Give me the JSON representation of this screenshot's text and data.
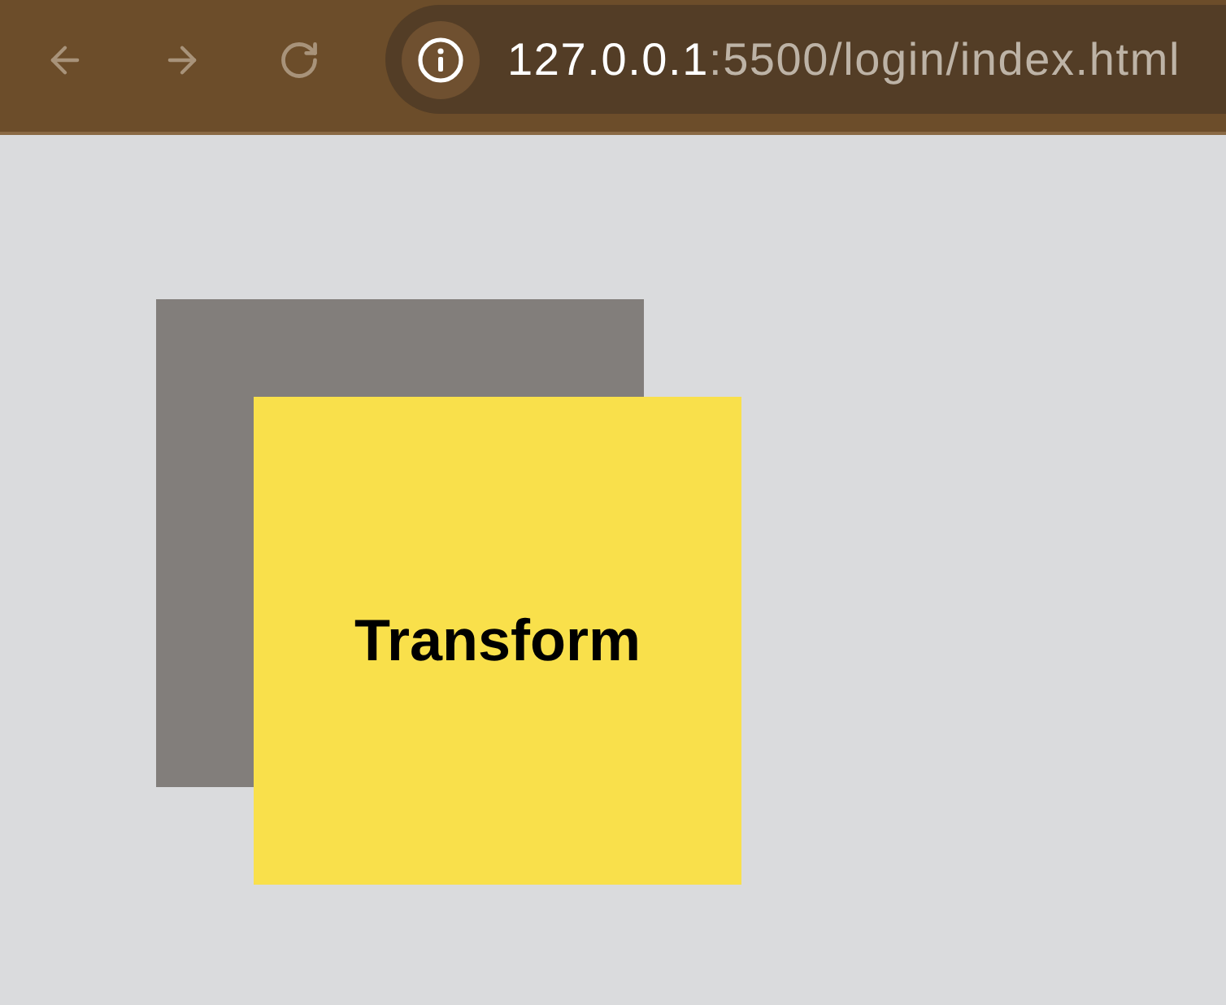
{
  "browser": {
    "nav_buttons": [
      {
        "kind": "back"
      },
      {
        "kind": "forward"
      },
      {
        "kind": "reload"
      }
    ],
    "address": {
      "host": "127.0.0.1",
      "path": ":5500/login/index.html"
    }
  },
  "page": {
    "boxes": [
      {
        "kind": "back"
      },
      {
        "kind": "front",
        "label": "Transform"
      }
    ]
  }
}
